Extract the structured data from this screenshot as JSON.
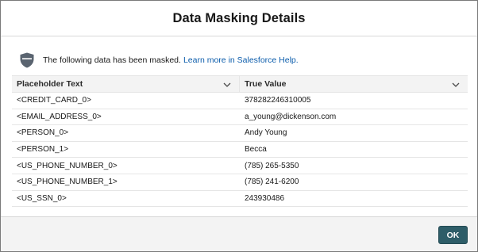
{
  "modal": {
    "title": "Data Masking Details"
  },
  "notice": {
    "icon": "shield-mask-icon",
    "text": "The following data has been masked.",
    "link_text": "Learn more in Salesforce Help."
  },
  "table": {
    "headers": [
      "Placeholder Text",
      "True Value"
    ],
    "rows": [
      {
        "placeholder": "<CREDIT_CARD_0>",
        "value": "378282246310005"
      },
      {
        "placeholder": "<EMAIL_ADDRESS_0>",
        "value": "a_young@dickenson.com"
      },
      {
        "placeholder": "<PERSON_0>",
        "value": "Andy Young"
      },
      {
        "placeholder": "<PERSON_1>",
        "value": "Becca"
      },
      {
        "placeholder": "<US_PHONE_NUMBER_0>",
        "value": "(785) 265-5350"
      },
      {
        "placeholder": "<US_PHONE_NUMBER_1>",
        "value": "(785) 241-6200"
      },
      {
        "placeholder": "<US_SSN_0>",
        "value": "243930486"
      }
    ]
  },
  "footer": {
    "ok_label": "OK"
  },
  "colors": {
    "primary_button": "#2e5d68",
    "link": "#0b5cab",
    "header_bg": "#f3f3f3",
    "icon": "#5a6470"
  }
}
